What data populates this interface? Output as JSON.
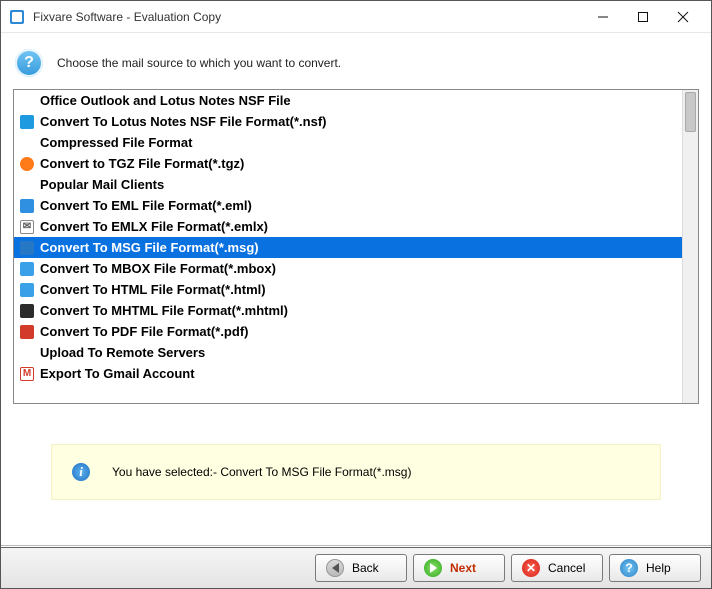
{
  "window": {
    "title": "Fixvare Software - Evaluation Copy"
  },
  "header": {
    "instruction": "Choose the mail source to which you want to convert."
  },
  "list": {
    "items": [
      {
        "kind": "group",
        "label": "Office Outlook and Lotus Notes NSF File",
        "icon": "none"
      },
      {
        "kind": "option",
        "label": "Convert To Lotus Notes NSF File Format(*.nsf)",
        "icon": "nsf",
        "selected": false
      },
      {
        "kind": "group",
        "label": "Compressed File Format",
        "icon": "none"
      },
      {
        "kind": "option",
        "label": "Convert to TGZ File Format(*.tgz)",
        "icon": "tgz",
        "selected": false
      },
      {
        "kind": "group",
        "label": "Popular Mail Clients",
        "icon": "none"
      },
      {
        "kind": "option",
        "label": "Convert To EML File Format(*.eml)",
        "icon": "eml",
        "selected": false
      },
      {
        "kind": "option",
        "label": "Convert To EMLX File Format(*.emlx)",
        "icon": "emlx",
        "selected": false
      },
      {
        "kind": "option",
        "label": "Convert To MSG File Format(*.msg)",
        "icon": "msg",
        "selected": true
      },
      {
        "kind": "option",
        "label": "Convert To MBOX File Format(*.mbox)",
        "icon": "mbox",
        "selected": false
      },
      {
        "kind": "option",
        "label": "Convert To HTML File Format(*.html)",
        "icon": "html",
        "selected": false
      },
      {
        "kind": "option",
        "label": "Convert To MHTML File Format(*.mhtml)",
        "icon": "mhtml",
        "selected": false
      },
      {
        "kind": "option",
        "label": "Convert To PDF File Format(*.pdf)",
        "icon": "pdf",
        "selected": false
      },
      {
        "kind": "group",
        "label": "Upload To Remote Servers",
        "icon": "none"
      },
      {
        "kind": "option",
        "label": "Export To Gmail Account",
        "icon": "gmail",
        "selected": false
      }
    ]
  },
  "icons": {
    "none": {
      "bg": "transparent",
      "glyph": ""
    },
    "nsf": {
      "bg": "#1e9ae0",
      "glyph": ""
    },
    "tgz": {
      "bg": "#ff7a18",
      "glyph": ""
    },
    "eml": {
      "bg": "#2f8fe0",
      "glyph": ""
    },
    "emlx": {
      "bg": "#ffffff",
      "glyph": "✉",
      "border": "#888"
    },
    "msg": {
      "bg": "#2778c4",
      "glyph": ""
    },
    "mbox": {
      "bg": "#3aa0e8",
      "glyph": ""
    },
    "html": {
      "bg": "#3aa0e8",
      "glyph": ""
    },
    "mhtml": {
      "bg": "#2b2b2b",
      "glyph": ""
    },
    "pdf": {
      "bg": "#d23a2a",
      "glyph": ""
    },
    "gmail": {
      "bg": "#ffffff",
      "glyph": "M",
      "border": "#d23a2a",
      "color": "#d23a2a"
    }
  },
  "status": {
    "prefix": "You have selected:- ",
    "selection": "Convert To MSG File Format(*.msg)"
  },
  "buttons": {
    "back": "Back",
    "next": "Next",
    "cancel": "Cancel",
    "help": "Help"
  }
}
